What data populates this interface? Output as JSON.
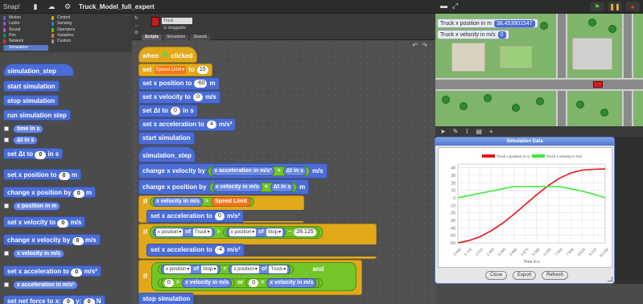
{
  "topbar": {
    "logo": "Snap!",
    "project_title": "Truck_Model_full_expert"
  },
  "categories": [
    {
      "label": "Motion",
      "color": "#4a6cd4"
    },
    {
      "label": "Control",
      "color": "#e1a91a"
    },
    {
      "label": "Looks",
      "color": "#8a55d7"
    },
    {
      "label": "Sensing",
      "color": "#0494dc"
    },
    {
      "label": "Sound",
      "color": "#cf4ad9"
    },
    {
      "label": "Operators",
      "color": "#62c213"
    },
    {
      "label": "Pen",
      "color": "#009870"
    },
    {
      "label": "Variables",
      "color": "#f3761d"
    },
    {
      "label": "Network",
      "color": "#e3312b"
    },
    {
      "label": "Custom",
      "color": "#969696"
    },
    {
      "label": "Simulation",
      "color": "#4a6cd4"
    }
  ],
  "palette": {
    "hat": "simulation_step",
    "start": "start simulation",
    "stop": "stop simulation",
    "run": "run simulation step",
    "time": "time in s",
    "dt": "Δt in s",
    "set_dt_pre": "set Δt to",
    "set_dt_val": "0",
    "set_dt_post": "in s",
    "set_x_pre": "set x position to",
    "set_x_val": "0",
    "set_x_post": "m",
    "chg_x_pre": "change x position by",
    "chg_x_val": "0",
    "chg_x_post": "m",
    "x_pos": "x position in m",
    "set_v_pre": "set x velocity to",
    "set_v_val": "0",
    "set_v_post": "m/s",
    "chg_v_pre": "change x velocity by",
    "chg_v_val": "0",
    "chg_v_post": "m/s",
    "x_vel": "x velocity in m/s",
    "set_a_pre": "set x acceleration to",
    "set_a_val": "0",
    "set_a_post": "m/s²",
    "x_acc": "x acceleration in m/s²",
    "set_f_pre": "set net force to x:",
    "set_f_val1": "0",
    "set_f_mid": "y:",
    "set_f_val2": "0",
    "set_f_post": "N"
  },
  "sprite": {
    "name": "Truck",
    "draggable": "draggable",
    "tabs": [
      "Scripts",
      "Simulation",
      "Sounds"
    ]
  },
  "script": {
    "when_pre": "when",
    "when_post": "clicked",
    "set_pre": "set",
    "var_speed": "Speed Limit",
    "set_to": "to",
    "speed_val": "15",
    "sx_pre": "set x position to",
    "sx_val": "-60",
    "sx_post": "m",
    "sv_pre": "set x velocity to",
    "sv_val": "0",
    "sv_post": "m/s",
    "sdt_pre": "set Δt to",
    "sdt_val": "0",
    "sdt_post": "in s",
    "sa_pre": "set x acceleration to",
    "sa_val": "4",
    "sa_post": "m/s²",
    "start": "start simulation",
    "hat2": "simulation_step",
    "cv_pre": "change x velocity by",
    "cv_a": "x acceleration in m/s²",
    "times": "×",
    "cv_dt": "Δt in s",
    "cv_post": "m/s",
    "cp_pre": "change x position by",
    "cp_v": "x velocity in m/s",
    "cp_dt": "Δt in s",
    "cp_post": "m",
    "if1": "if",
    "if1_v": "x velocity in m/s",
    "gt": ">",
    "if1_sl": "Speed Limit",
    "if1_body_pre": "set x acceleration to",
    "if1_body_val": "0",
    "if1_body_post": "m/s²",
    "if2": "if",
    "xpos": "x position",
    "of": "of",
    "truck": "Truck",
    "stop_obj": "Stop",
    "minus": "−",
    "num": "28.125",
    "if2_body_pre": "set x acceleration to",
    "if2_body_val": "-4",
    "if2_body_post": "m/s²",
    "if3": "if",
    "lt": "<",
    "and": "and",
    "zero": "0",
    "or": "or",
    "eq": "=",
    "stop": "stop simulation"
  },
  "stage": {
    "watch1_label": "Truck x position in m",
    "watch1_val": "38.453901547",
    "watch2_label": "Truck x velocity in m/s",
    "watch2_val": "0"
  },
  "dialog": {
    "title": "Simulation Data",
    "buttons": [
      "Close",
      "Export",
      "Refresh"
    ]
  },
  "chart_data": {
    "type": "line",
    "title": "",
    "xlabel": "Time in s",
    "ylabel": "",
    "x_ticks": [
      "0.000",
      "0.745",
      "1.515",
      "2.305",
      "3.095",
      "3.885",
      "4.675",
      "5.465",
      "6.255",
      "7.045",
      "7.835",
      "8.625",
      "9.415",
      "10.232"
    ],
    "ylim": [
      -60,
      45
    ],
    "y_ticks": [
      40,
      30,
      20,
      10,
      0,
      -10,
      -20,
      -30,
      -40,
      -50,
      -60
    ],
    "legend_position": "top",
    "series": [
      {
        "name": "Truck x position in m",
        "color": "#e8101a",
        "x": [
          0,
          0.745,
          1.515,
          2.305,
          3.095,
          3.885,
          4.675,
          5.465,
          6.255,
          7.045,
          7.835,
          8.625,
          9.415,
          10.232
        ],
        "y": [
          -60,
          -57,
          -52,
          -44,
          -34,
          -22,
          -9,
          4,
          16,
          26,
          33,
          37,
          38,
          38.5
        ]
      },
      {
        "name": "Truck x velocity in m/s",
        "color": "#3ee83a",
        "x": [
          0,
          0.745,
          1.515,
          2.305,
          3.095,
          3.885,
          4.675,
          5.465,
          6.255,
          7.045,
          7.835,
          8.625,
          9.415,
          10.232
        ],
        "y": [
          0,
          3,
          6,
          9,
          12,
          15,
          15,
          15,
          15,
          15,
          12,
          9,
          5,
          0
        ]
      }
    ],
    "grid": true
  }
}
